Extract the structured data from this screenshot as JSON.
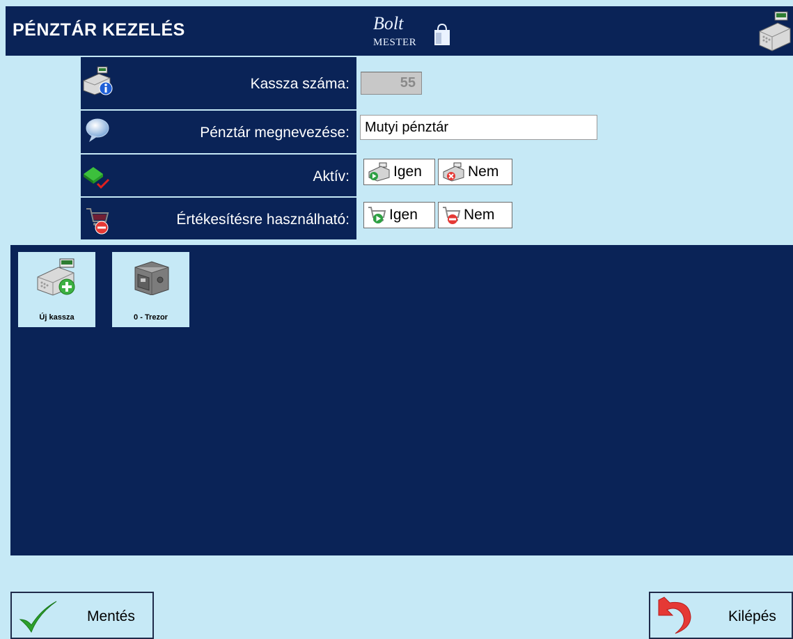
{
  "header": {
    "title": "PÉNZTÁR KEZELÉS",
    "logo_line1": "Bolt",
    "logo_line2": "MESTER"
  },
  "form": {
    "register_number": {
      "label": "Kassza száma:",
      "value": "55"
    },
    "name": {
      "label": "Pénztár megnevezése:",
      "value": "Mutyi pénztár"
    },
    "active": {
      "label": "Aktív:",
      "yes": "Igen",
      "no": "Nem"
    },
    "sellable": {
      "label": "Értékesítésre használható:",
      "yes": "Igen",
      "no": "Nem"
    }
  },
  "tiles": [
    {
      "label": "Új kassza",
      "icon": "cash-register-add-icon"
    },
    {
      "label": "0 - Trezor",
      "icon": "safe-icon"
    }
  ],
  "footer": {
    "save_label": "Mentés",
    "exit_label": "Kilépés"
  },
  "colors": {
    "navy": "#0a2357",
    "light_blue": "#c6e9f6",
    "save_check": "#2ca02c",
    "exit_arrow": "#e03030"
  }
}
